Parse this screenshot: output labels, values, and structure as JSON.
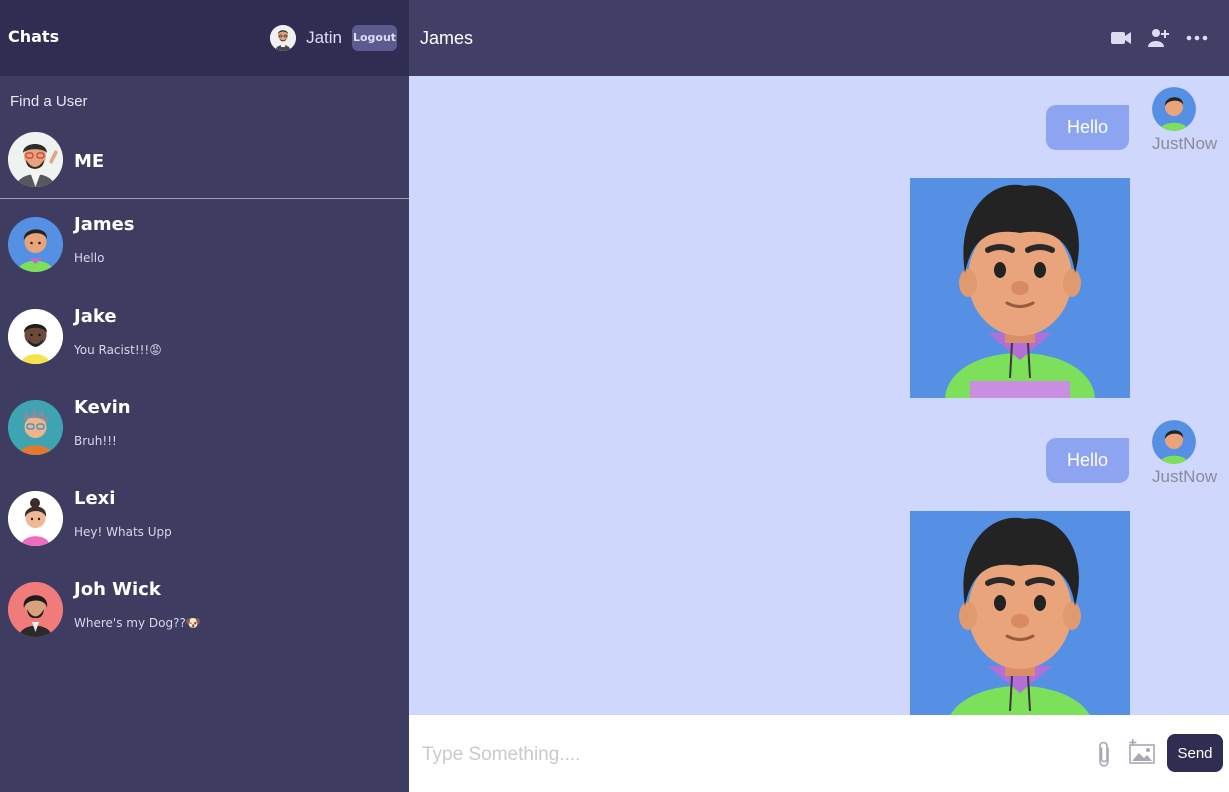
{
  "navbar": {
    "logo": "Chats",
    "username": "Jatin",
    "logout_label": "Logout"
  },
  "search": {
    "placeholder": "Find a User"
  },
  "me": {
    "name": "ME"
  },
  "chats": [
    {
      "name": "James",
      "last_message": "Hello",
      "emoji": ""
    },
    {
      "name": "Jake",
      "last_message": "You Racist!!!",
      "emoji": "😡"
    },
    {
      "name": "Kevin",
      "last_message": "Bruh!!!",
      "emoji": ""
    },
    {
      "name": "Lexi",
      "last_message": "Hey! Whats Upp",
      "emoji": ""
    },
    {
      "name": "Joh Wick",
      "last_message": "Where's my Dog??",
      "emoji": "🐶"
    }
  ],
  "chat": {
    "title": "James",
    "icons": [
      "video-camera-icon",
      "add-user-icon",
      "more-options-icon"
    ]
  },
  "messages": [
    {
      "text": "Hello",
      "time": "JustNow",
      "has_image": true
    },
    {
      "text": "Hello",
      "time": "JustNow",
      "has_image": true
    }
  ],
  "input": {
    "placeholder": "Type Something....",
    "send_label": "Send"
  },
  "colors": {
    "sidebar_bg": "#3e3c61",
    "navbar_bg": "#2f2d52",
    "chat_header_bg": "#413f66",
    "messages_bg": "#cfd8fc",
    "bubble_bg": "#8da4f1",
    "send_button_bg": "#2f2d52"
  }
}
